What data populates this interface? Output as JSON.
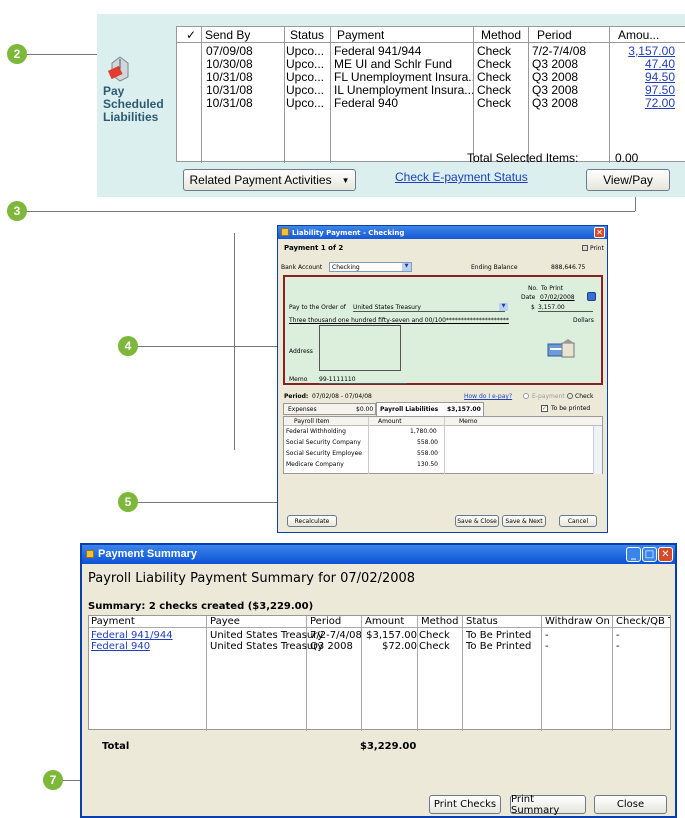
{
  "callouts": {
    "c2": "2",
    "c3": "3",
    "c4": "4",
    "c5": "5",
    "c7": "7"
  },
  "top_list": {
    "sidebar_label_lines": [
      "Pay",
      "Scheduled",
      "Liabilities"
    ],
    "columns": [
      "✓",
      "Send By",
      "Status",
      "Payment",
      "Method",
      "Period",
      "Amou..."
    ],
    "rows": [
      {
        "send_by": "07/09/08",
        "status": "Upco...",
        "payment": "Federal 941/944",
        "method": "Check",
        "period": "7/2-7/4/08",
        "amount": "3,157.00"
      },
      {
        "send_by": "10/30/08",
        "status": "Upco...",
        "payment": "ME UI and Schlr Fund",
        "method": "Check",
        "period": "Q3 2008",
        "amount": "47.40"
      },
      {
        "send_by": "10/31/08",
        "status": "Upco...",
        "payment": "FL Unemployment Insura...",
        "method": "Check",
        "period": "Q3 2008",
        "amount": "94.50"
      },
      {
        "send_by": "10/31/08",
        "status": "Upco...",
        "payment": "IL Unemployment Insura...",
        "method": "Check",
        "period": "Q3 2008",
        "amount": "97.50"
      },
      {
        "send_by": "10/31/08",
        "status": "Upco...",
        "payment": "Federal 940",
        "method": "Check",
        "period": "Q3 2008",
        "amount": "72.00"
      }
    ],
    "total_selected_label": "Total Selected Items:",
    "total_selected_value": "0.00",
    "related_button": "Related Payment Activities",
    "check_status_link": "Check E-payment Status",
    "view_pay_button": "View/Pay"
  },
  "liability_window": {
    "title": "Liability Payment - Checking",
    "payment_of": "Payment 1 of 2",
    "print": "Print",
    "bank_account_label": "Bank Account",
    "bank_account_value": "Checking",
    "ending_balance_label": "Ending Balance",
    "ending_balance_value": "888,646.75",
    "no_label": "No.",
    "no_value": "To Print",
    "date_label": "Date",
    "date_value": "07/02/2008",
    "pay_to_label": "Pay to the Order of",
    "pay_to_value": "United States Treasury",
    "dollar_sign": "$",
    "amount_value": "3,157.00",
    "amount_words": "Three thousand one hundred fifty-seven and 00/100*********************",
    "dollars_label": "Dollars",
    "address_label": "Address",
    "memo_label": "Memo",
    "memo_value": "99-1111110",
    "period_label": "Period:",
    "period_value": "07/02/08 - 07/04/08",
    "how_epay": "How do I e-pay?",
    "epayment_label": "E-payment",
    "check_label": "Check",
    "expenses_tab": "Expenses",
    "expenses_amount": "$0.00",
    "payroll_tab": "Payroll Liabilities",
    "payroll_amount": "$3,157.00",
    "to_be_printed": "To be printed",
    "grid_headers": [
      "Payroll Item",
      "Amount",
      "Memo"
    ],
    "grid_rows": [
      {
        "item": "Federal Withholding",
        "amount": "1,780.00"
      },
      {
        "item": "Social Security Company",
        "amount": "558.00"
      },
      {
        "item": "Social Security Employee",
        "amount": "558.00"
      },
      {
        "item": "Medicare Company",
        "amount": "130.50"
      }
    ],
    "recalculate": "Recalculate",
    "save_close": "Save & Close",
    "save_next": "Save & Next",
    "cancel": "Cancel"
  },
  "summary_window": {
    "title": "Payment Summary",
    "heading": "Payroll Liability Payment Summary for 07/02/2008",
    "summary_line": "Summary: 2 checks created ($3,229.00)",
    "columns": [
      "Payment",
      "Payee",
      "Period",
      "Amount",
      "Method",
      "Status",
      "Withdraw On",
      "Check/QB Tra..."
    ],
    "rows": [
      {
        "payment": "Federal 941/944",
        "payee": "United States Treasury",
        "period": "7/2-7/4/08",
        "amount": "$3,157.00",
        "method": "Check",
        "status": "To Be Printed",
        "withdraw": "-",
        "check": "-"
      },
      {
        "payment": "Federal 940",
        "payee": "United States Treasury",
        "period": "Q3 2008",
        "amount": "$72.00",
        "method": "Check",
        "status": "To Be Printed",
        "withdraw": "-",
        "check": "-"
      }
    ],
    "total_label": "Total",
    "total_value": "$3,229.00",
    "print_checks": "Print Checks",
    "print_summary": "Print Summary",
    "close": "Close"
  },
  "colors": {
    "callout_green": "#7db83a",
    "panel_teal": "#dcefef",
    "xp_blue": "#0a3fb0",
    "check_green": "#dcefdc",
    "check_border": "#8b2020"
  }
}
